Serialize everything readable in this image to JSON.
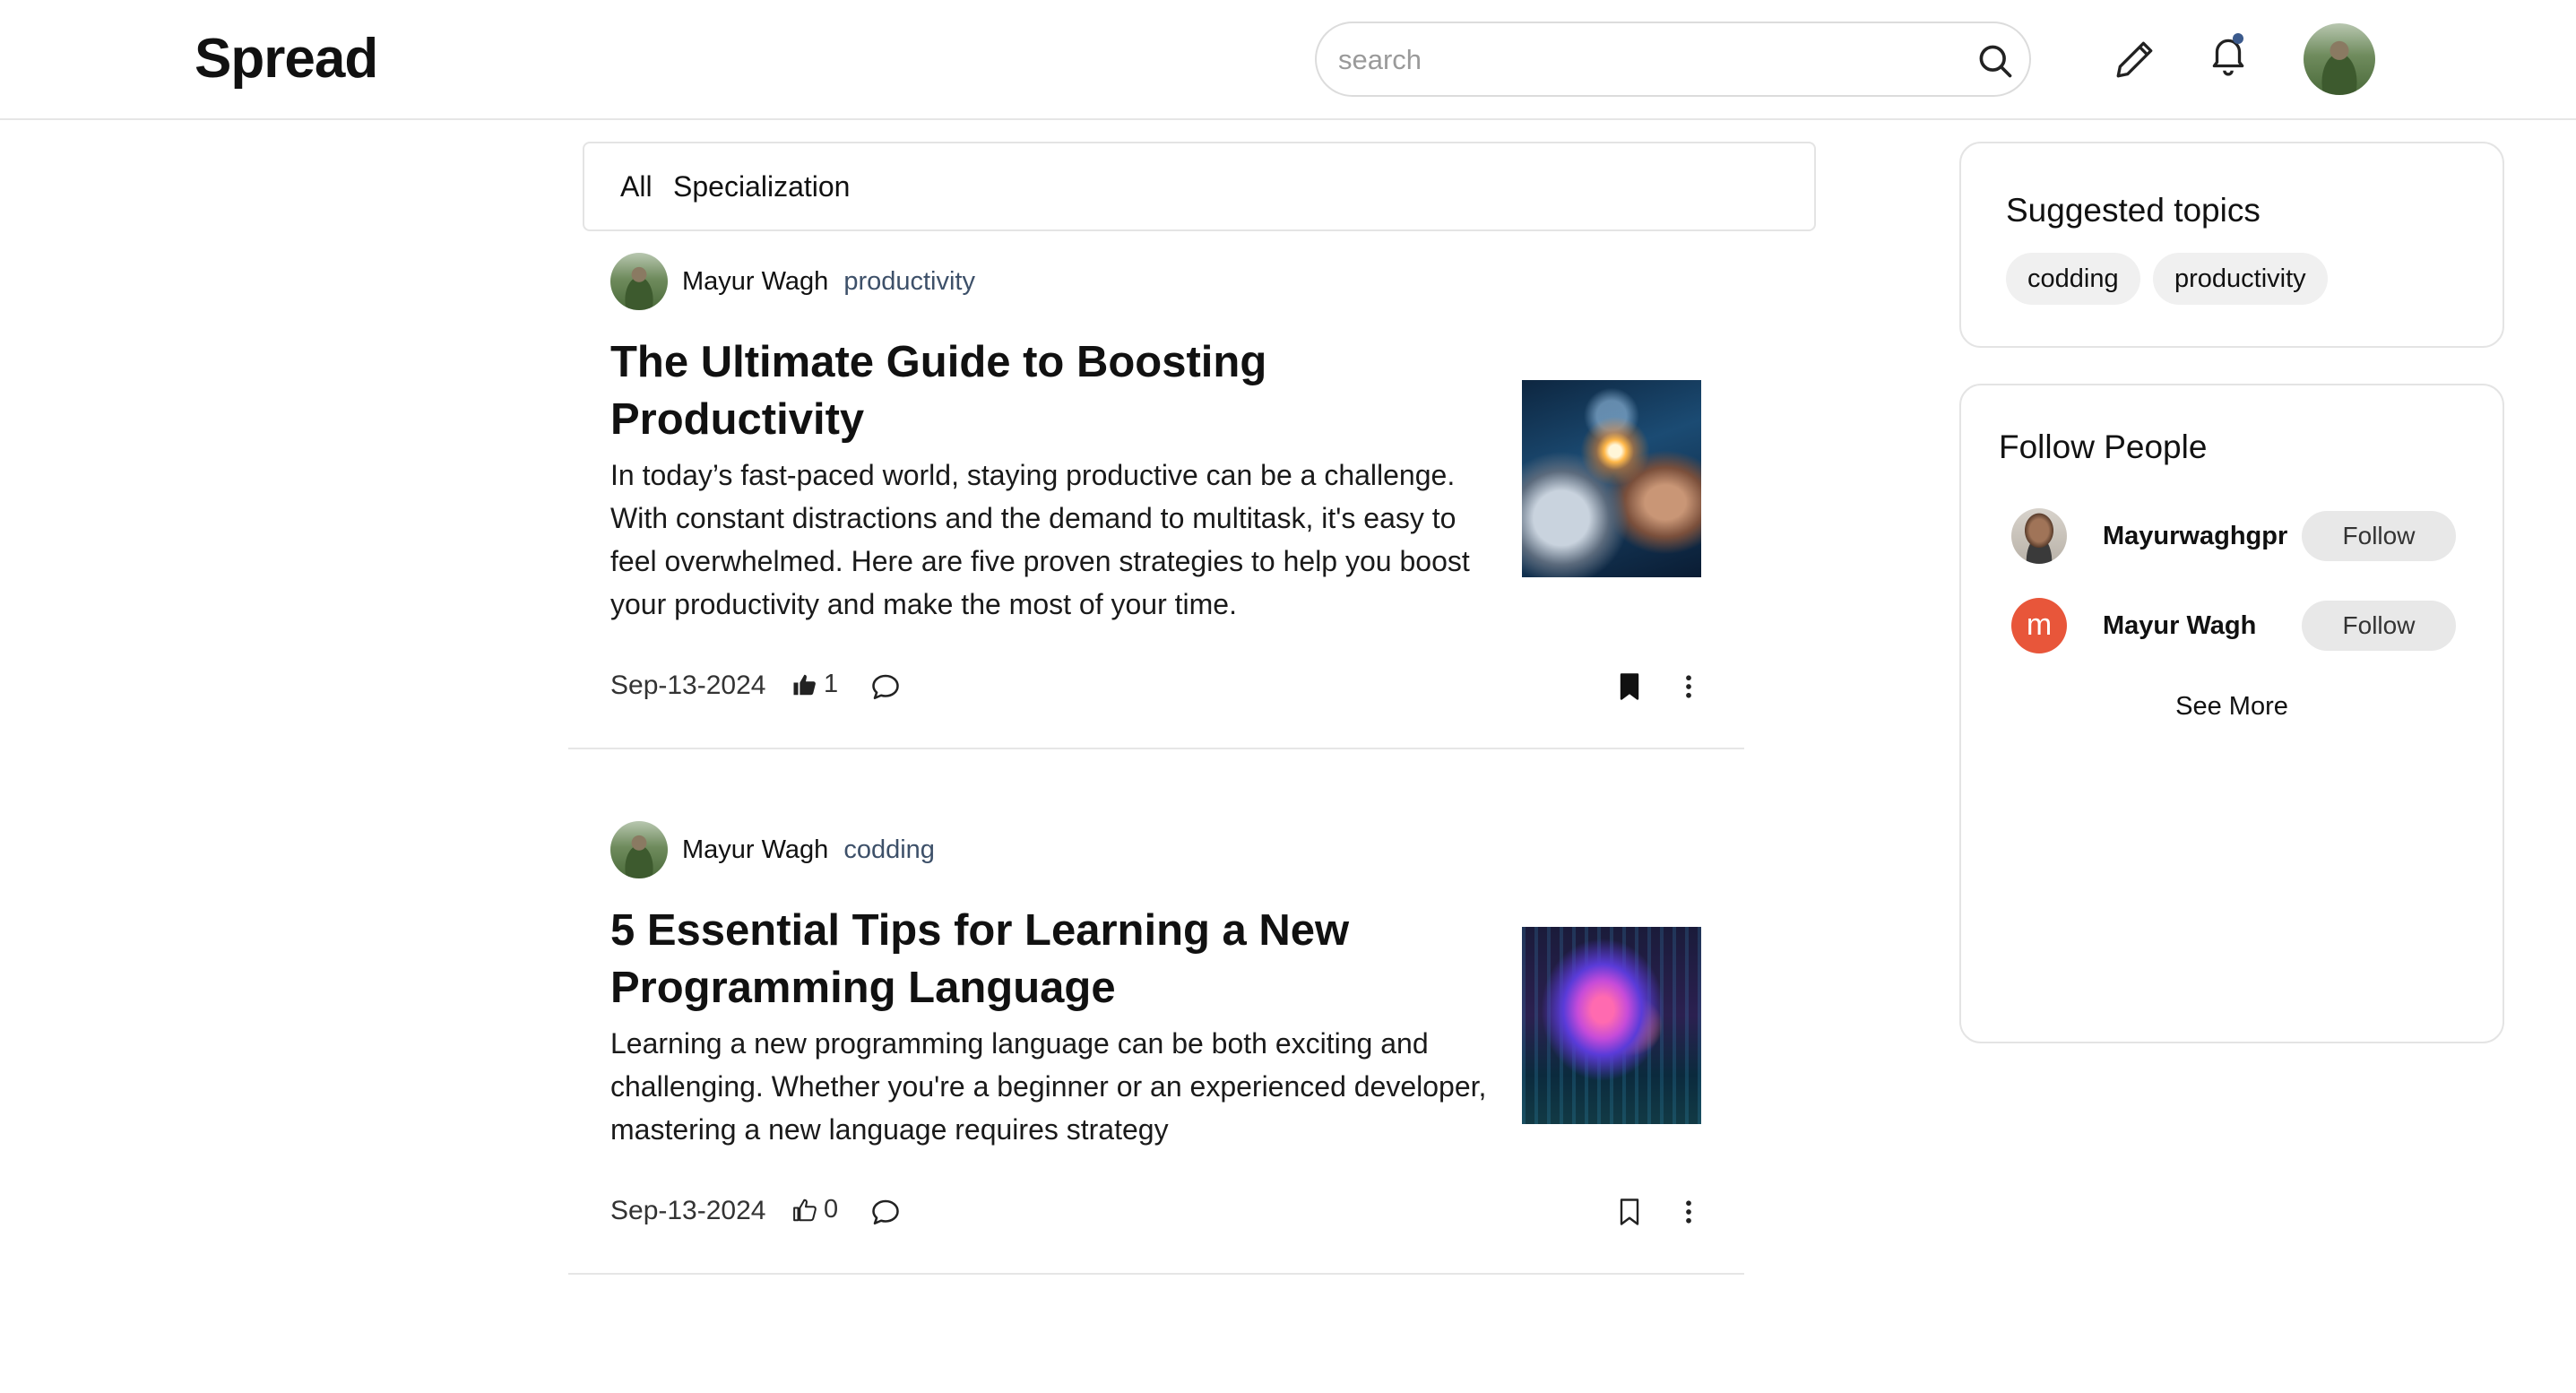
{
  "header": {
    "logo": "Spread",
    "search_placeholder": "search",
    "icons": {
      "search": "search-icon",
      "write": "pen-icon",
      "notifications": "bell-icon"
    },
    "accent_color": "#3b5a8c"
  },
  "filters": {
    "all": "All",
    "specialization": "Specialization"
  },
  "posts": [
    {
      "author": "Mayur Wagh",
      "topic": "productivity",
      "title": "The Ultimate Guide to Boosting Productivity",
      "excerpt": "In today’s fast-paced world, staying productive can be a challenge. With constant distractions and the demand to multitask, it's easy to feel overwhelmed. Here are five proven strategies to help you boost your productivity and make the most of your time.",
      "date": "Sep-13-2024",
      "likes": "1",
      "liked": true,
      "bookmarked": true
    },
    {
      "author": "Mayur Wagh",
      "topic": "codding",
      "title": "5 Essential Tips for Learning a New Programming Language",
      "excerpt": "Learning a new programming language can be both exciting and challenging. Whether you're a beginner or an experienced developer, mastering a new language requires strategy",
      "date": "Sep-13-2024",
      "likes": "0",
      "liked": false,
      "bookmarked": false
    }
  ],
  "suggested_topics": {
    "title": "Suggested topics",
    "topics": [
      "codding",
      "productivity"
    ]
  },
  "follow_people": {
    "title": "Follow People",
    "people": [
      {
        "name": "Mayurwaghgpr",
        "button": "Follow"
      },
      {
        "name": "Mayur Wagh",
        "initial": "m",
        "avatar_color": "#e8563a",
        "button": "Follow"
      }
    ],
    "see_more": "See More"
  }
}
